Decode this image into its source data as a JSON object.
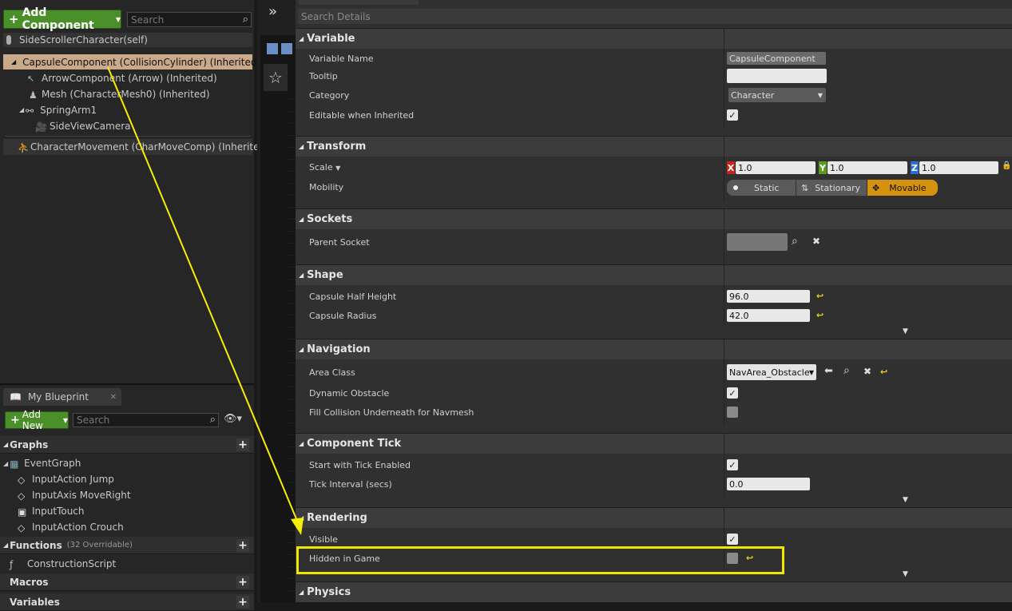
{
  "components": {
    "add_label": "Add Component",
    "search_placeholder": "Search",
    "items": [
      "SideScrollerCharacter(self)",
      "CapsuleComponent (CollisionCylinder) (Inherited)",
      "ArrowComponent (Arrow) (Inherited)",
      "Mesh (CharacterMesh0) (Inherited)",
      "SpringArm1",
      "SideViewCamera",
      "CharacterMovement (CharMoveComp) (Inherited)"
    ]
  },
  "my_blueprint": {
    "tab_label": "My Blueprint",
    "add_label": "Add New",
    "search_placeholder": "Search",
    "graphs_label": "Graphs",
    "graph_items": [
      "EventGraph",
      "InputAction Jump",
      "InputAxis MoveRight",
      "InputTouch",
      "InputAction Crouch"
    ],
    "functions_label": "Functions",
    "functions_count": "(32 Overridable)",
    "function_items": [
      "ConstructionScript"
    ],
    "macros_label": "Macros",
    "variables_label": "Variables"
  },
  "details": {
    "search_placeholder": "Search Details",
    "sections": {
      "variable": "Variable",
      "transform": "Transform",
      "sockets": "Sockets",
      "shape": "Shape",
      "navigation": "Navigation",
      "component_tick": "Component Tick",
      "rendering": "Rendering",
      "physics": "Physics"
    },
    "props": {
      "variable_name": "Variable Name",
      "variable_name_value": "CapsuleComponent",
      "tooltip": "Tooltip",
      "category": "Category",
      "category_value": "Character",
      "editable_inherited": "Editable when Inherited",
      "scale": "Scale",
      "scale_x": "1.0",
      "scale_y": "1.0",
      "scale_z": "1.0",
      "mobility": "Mobility",
      "mobility_static": "Static",
      "mobility_stationary": "Stationary",
      "mobility_movable": "Movable",
      "parent_socket": "Parent Socket",
      "capsule_half_height": "Capsule Half Height",
      "capsule_half_height_value": "96.0",
      "capsule_radius": "Capsule Radius",
      "capsule_radius_value": "42.0",
      "area_class": "Area Class",
      "area_class_value": "NavArea_Obstacle",
      "dynamic_obstacle": "Dynamic Obstacle",
      "fill_collision": "Fill Collision Underneath for Navmesh",
      "start_tick": "Start with Tick Enabled",
      "tick_interval": "Tick Interval (secs)",
      "tick_interval_value": "0.0",
      "visible": "Visible",
      "hidden_in_game": "Hidden in Game"
    },
    "checks": {
      "editable_inherited": true,
      "dynamic_obstacle": true,
      "fill_collision": false,
      "start_tick": true,
      "visible": true,
      "hidden_in_game": false
    }
  },
  "colors": {
    "highlight_box": "#f2e600",
    "arrow": "#f5f000",
    "accent_green": "#4b8f2b",
    "movable_orange": "#d4920e",
    "selected_row": "#c9a98a"
  }
}
